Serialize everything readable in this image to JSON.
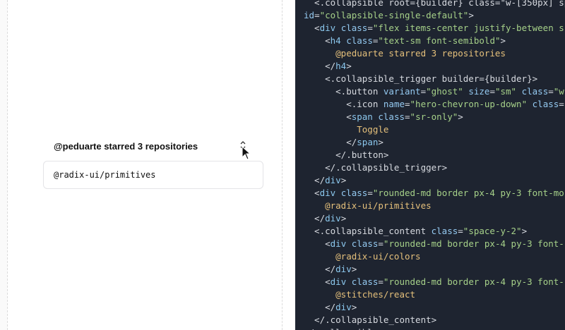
{
  "preview": {
    "heading": "@peduarte starred 3 repositories",
    "toggle_label": "Toggle",
    "visible_repo": "@radix-ui/primitives"
  },
  "code_lines": [
    [
      {
        "c": "t-punc",
        "t": "  <.collapsible root={builder} class=\"w-[350px] space-"
      }
    ],
    [
      {
        "c": "t-attr",
        "t": "id"
      },
      {
        "c": "t-punc",
        "t": "="
      },
      {
        "c": "t-str",
        "t": "\"collapsible-single-default\""
      },
      {
        "c": "t-punc",
        "t": ">"
      }
    ],
    [
      {
        "c": "t-punc",
        "t": "  <"
      },
      {
        "c": "t-tag",
        "t": "div"
      },
      {
        "c": "t-punc",
        "t": " "
      },
      {
        "c": "t-attr",
        "t": "class"
      },
      {
        "c": "t-punc",
        "t": "="
      },
      {
        "c": "t-str",
        "t": "\"flex items-center justify-between s"
      }
    ],
    [
      {
        "c": "t-punc",
        "t": "    <"
      },
      {
        "c": "t-tag",
        "t": "h4"
      },
      {
        "c": "t-punc",
        "t": " "
      },
      {
        "c": "t-attr",
        "t": "class"
      },
      {
        "c": "t-punc",
        "t": "="
      },
      {
        "c": "t-str",
        "t": "\"text-sm font-semibold\""
      },
      {
        "c": "t-punc",
        "t": ">"
      }
    ],
    [
      {
        "c": "t-txt",
        "t": "      @peduarte starred 3 repositories"
      }
    ],
    [
      {
        "c": "t-punc",
        "t": "    </"
      },
      {
        "c": "t-tag",
        "t": "h4"
      },
      {
        "c": "t-punc",
        "t": ">"
      }
    ],
    [
      {
        "c": "t-punc",
        "t": "    <.collapsible_trigger builder={builder}>"
      }
    ],
    [
      {
        "c": "t-punc",
        "t": "      <.button "
      },
      {
        "c": "t-attr",
        "t": "variant"
      },
      {
        "c": "t-punc",
        "t": "="
      },
      {
        "c": "t-str",
        "t": "\"ghost\""
      },
      {
        "c": "t-punc",
        "t": " "
      },
      {
        "c": "t-attr",
        "t": "size"
      },
      {
        "c": "t-punc",
        "t": "="
      },
      {
        "c": "t-str",
        "t": "\"sm\""
      },
      {
        "c": "t-punc",
        "t": " "
      },
      {
        "c": "t-attr",
        "t": "class"
      },
      {
        "c": "t-punc",
        "t": "="
      },
      {
        "c": "t-str",
        "t": "\"w"
      }
    ],
    [
      {
        "c": "t-punc",
        "t": "        <.icon "
      },
      {
        "c": "t-attr",
        "t": "name"
      },
      {
        "c": "t-punc",
        "t": "="
      },
      {
        "c": "t-str",
        "t": "\"hero-chevron-up-down\""
      },
      {
        "c": "t-punc",
        "t": " "
      },
      {
        "c": "t-attr",
        "t": "class"
      },
      {
        "c": "t-punc",
        "t": "="
      }
    ],
    [
      {
        "c": "t-punc",
        "t": "        <"
      },
      {
        "c": "t-tag",
        "t": "span"
      },
      {
        "c": "t-punc",
        "t": " "
      },
      {
        "c": "t-attr",
        "t": "class"
      },
      {
        "c": "t-punc",
        "t": "="
      },
      {
        "c": "t-str",
        "t": "\"sr-only\""
      },
      {
        "c": "t-punc",
        "t": ">"
      }
    ],
    [
      {
        "c": "t-txt",
        "t": "          Toggle"
      }
    ],
    [
      {
        "c": "t-punc",
        "t": "        </"
      },
      {
        "c": "t-tag",
        "t": "span"
      },
      {
        "c": "t-punc",
        "t": ">"
      }
    ],
    [
      {
        "c": "t-punc",
        "t": "      </.button>"
      }
    ],
    [
      {
        "c": "t-punc",
        "t": "    </.collapsible_trigger>"
      }
    ],
    [
      {
        "c": "t-punc",
        "t": "  </"
      },
      {
        "c": "t-tag",
        "t": "div"
      },
      {
        "c": "t-punc",
        "t": ">"
      }
    ],
    [
      {
        "c": "t-punc",
        "t": "  <"
      },
      {
        "c": "t-tag",
        "t": "div"
      },
      {
        "c": "t-punc",
        "t": " "
      },
      {
        "c": "t-attr",
        "t": "class"
      },
      {
        "c": "t-punc",
        "t": "="
      },
      {
        "c": "t-str",
        "t": "\"rounded-md border px-4 py-3 font-mo"
      }
    ],
    [
      {
        "c": "t-txt",
        "t": "    @radix-ui/primitives"
      }
    ],
    [
      {
        "c": "t-punc",
        "t": "  </"
      },
      {
        "c": "t-tag",
        "t": "div"
      },
      {
        "c": "t-punc",
        "t": ">"
      }
    ],
    [
      {
        "c": "t-punc",
        "t": "  <.collapsible_content "
      },
      {
        "c": "t-attr",
        "t": "class"
      },
      {
        "c": "t-punc",
        "t": "="
      },
      {
        "c": "t-str",
        "t": "\"space-y-2\""
      },
      {
        "c": "t-punc",
        "t": ">"
      }
    ],
    [
      {
        "c": "t-punc",
        "t": "    <"
      },
      {
        "c": "t-tag",
        "t": "div"
      },
      {
        "c": "t-punc",
        "t": " "
      },
      {
        "c": "t-attr",
        "t": "class"
      },
      {
        "c": "t-punc",
        "t": "="
      },
      {
        "c": "t-str",
        "t": "\"rounded-md border px-4 py-3 font-"
      }
    ],
    [
      {
        "c": "t-txt",
        "t": "      @radix-ui/colors"
      }
    ],
    [
      {
        "c": "t-punc",
        "t": "    </"
      },
      {
        "c": "t-tag",
        "t": "div"
      },
      {
        "c": "t-punc",
        "t": ">"
      }
    ],
    [
      {
        "c": "t-punc",
        "t": "    <"
      },
      {
        "c": "t-tag",
        "t": "div"
      },
      {
        "c": "t-punc",
        "t": " "
      },
      {
        "c": "t-attr",
        "t": "class"
      },
      {
        "c": "t-punc",
        "t": "="
      },
      {
        "c": "t-str",
        "t": "\"rounded-md border px-4 py-3 font-"
      }
    ],
    [
      {
        "c": "t-txt",
        "t": "      @stitches/react"
      }
    ],
    [
      {
        "c": "t-punc",
        "t": "    </"
      },
      {
        "c": "t-tag",
        "t": "div"
      },
      {
        "c": "t-punc",
        "t": ">"
      }
    ],
    [
      {
        "c": "t-punc",
        "t": "  </.collapsible_content>"
      }
    ],
    [
      {
        "c": "t-punc",
        "t": "</.collapsible>"
      }
    ]
  ],
  "colors": {
    "code_bg": "#1e2430",
    "tag": "#8cc8ee",
    "string": "#a6d189",
    "text": "#e5c07b"
  },
  "icons": {
    "toggle": "chevron-up-down-icon",
    "pointer": "mouse-pointer-icon"
  }
}
